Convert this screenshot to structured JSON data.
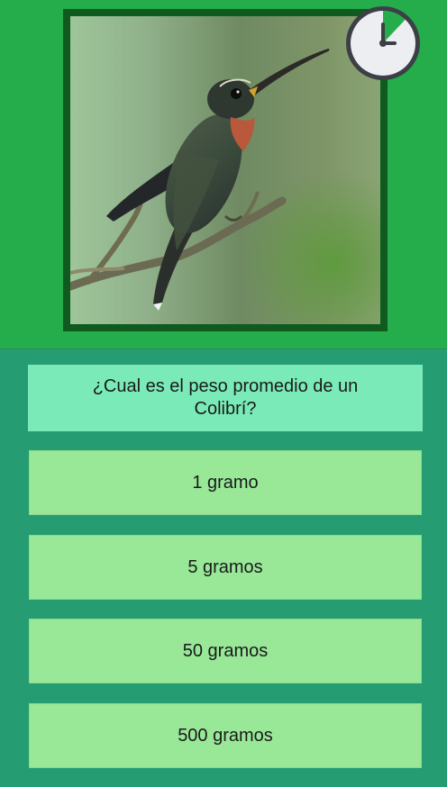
{
  "quiz": {
    "image": "hummingbird-photo",
    "timer_icon": "clock-timer-icon",
    "timer_remaining_fraction": 0.88,
    "question": "¿Cual es el peso promedio de un Colibrí?",
    "answers": [
      {
        "label": "1 gramo"
      },
      {
        "label": "5 gramos"
      },
      {
        "label": "50 gramos"
      },
      {
        "label": "500 gramos"
      }
    ]
  },
  "colors": {
    "background_top": "#24ad4a",
    "panel": "#269c73",
    "question_bg": "#7aebb8",
    "answer_bg": "#98e898",
    "timer_fill": "#24ad4a"
  }
}
